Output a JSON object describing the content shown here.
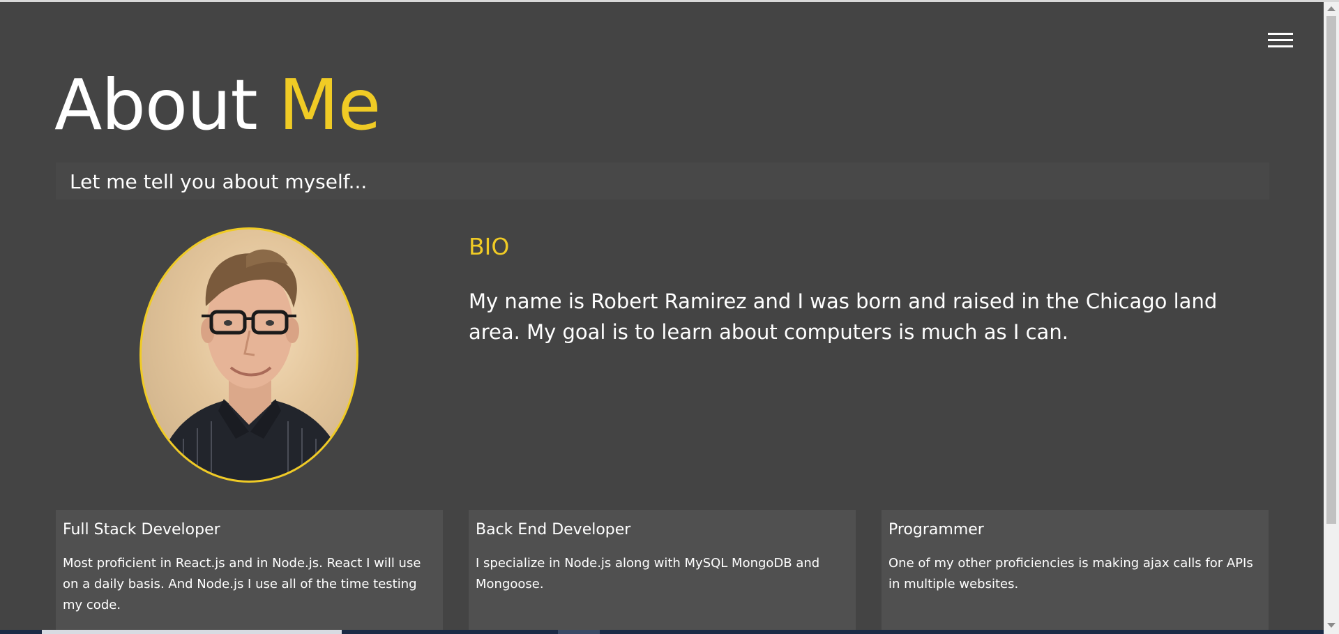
{
  "header": {
    "title_main": "About",
    "title_accent": "Me",
    "subtitle": "Let me tell you about myself..."
  },
  "menu": {
    "icon": "hamburger-menu-icon"
  },
  "bio": {
    "title": "BIO",
    "text": "My name is Robert Ramirez and I was born and raised in the Chicago land area. My goal is to learn about computers is much as I can."
  },
  "cards": [
    {
      "title": "Full Stack Developer",
      "text": "Most proficient in React.js and in Node.js. React I will use on a daily basis. And Node.js I use all of the time testing my code."
    },
    {
      "title": "Back End Developer",
      "text": "I specialize in Node.js along with MySQL MongoDB and Mongoose."
    },
    {
      "title": "Programmer",
      "text": "One of my other proficiencies is making ajax calls for APIs in multiple websites."
    }
  ],
  "colors": {
    "background": "#444444",
    "accent": "#f0cb25",
    "card": "#505050",
    "subtitle_bar": "#484848"
  }
}
